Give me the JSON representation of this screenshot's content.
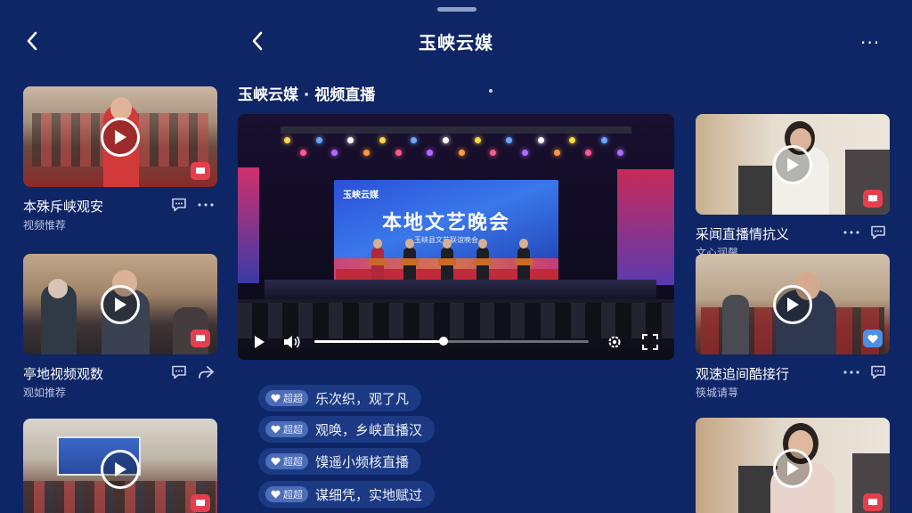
{
  "header": {
    "title": "玉峡云媒",
    "more_label": "···"
  },
  "section": {
    "title": "玉峡云媒 · 视频直播"
  },
  "player": {
    "stage_logo": "玉峡云媒",
    "stage_title": "本地文艺晚会",
    "stage_subtitle": "玉峡县文艺联谊晚会",
    "progress": 0.47
  },
  "left_cards": [
    {
      "title": "本殊斥峡观安",
      "sub": "视频惟荐",
      "badge": "red"
    },
    {
      "title": "亭地视频观数",
      "sub": "观如推荐",
      "badge": "red"
    },
    {
      "title": "",
      "sub": "",
      "badge": "red"
    }
  ],
  "right_cards": [
    {
      "title": "采闻直播情抗义",
      "sub": "文心润馨",
      "badge": "red"
    },
    {
      "title": "观速追间酷接行",
      "sub": "筷城请荨",
      "badge": "blue"
    },
    {
      "title": "",
      "sub": "",
      "badge": "red"
    }
  ],
  "comments": [
    {
      "tag": "超超",
      "text": "乐次织，观了凡"
    },
    {
      "tag": "超超",
      "text": "观唤，乡峡直播汉"
    },
    {
      "tag": "超超",
      "text": "馍遥小频核直播"
    },
    {
      "tag": "超超",
      "text": "谋细凭，实地赋过"
    }
  ],
  "colors": {
    "background": "#0e2566",
    "badge_red": "#e53f4f",
    "badge_blue": "#4b8fe8",
    "comment_bg": "#1c3a84"
  },
  "icons": {
    "back": "chevron-left-icon",
    "play": "play-icon",
    "volume": "volume-icon",
    "fullscreen": "fullscreen-icon",
    "settings": "settings-icon",
    "comment": "comment-icon",
    "share": "share-icon",
    "heart": "heart-icon"
  }
}
